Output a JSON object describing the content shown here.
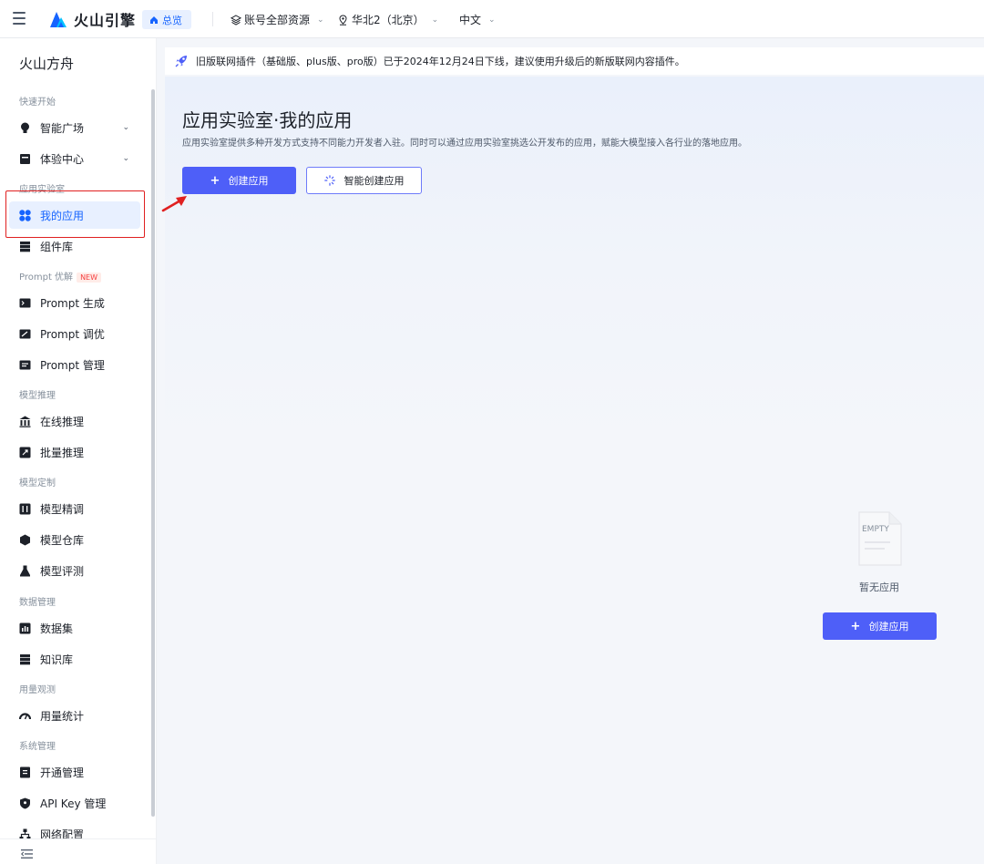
{
  "header": {
    "logo_text": "火山引擎",
    "home_label": "总览",
    "account_scope": "账号全部资源",
    "region": "华北2（北京）",
    "language": "中文"
  },
  "sidebar": {
    "title": "火山方舟",
    "groups": {
      "quick_start": "快速开始",
      "app_lab": "应用实验室",
      "prompt_opt": "Prompt 优解",
      "prompt_opt_badge": "NEW",
      "model_infer": "模型推理",
      "model_custom": "模型定制",
      "data_mgmt": "数据管理",
      "usage": "用量观测",
      "system": "系统管理"
    },
    "items": {
      "smart_square": "智能广场",
      "experience_center": "体验中心",
      "my_apps": "我的应用",
      "component_lib": "组件库",
      "prompt_gen": "Prompt 生成",
      "prompt_tune": "Prompt 调优",
      "prompt_manage": "Prompt 管理",
      "online_infer": "在线推理",
      "batch_infer": "批量推理",
      "model_finetune": "模型精调",
      "model_repo": "模型仓库",
      "model_eval": "模型评测",
      "dataset": "数据集",
      "knowledge_base": "知识库",
      "usage_stats": "用量统计",
      "activation": "开通管理",
      "api_key": "API Key 管理",
      "network_config": "网络配置"
    },
    "active_item": "my_apps"
  },
  "notice": {
    "text": "旧版联网插件（基础版、plus版、pro版）已于2024年12月24日下线，建议使用升级后的新版联网内容插件。"
  },
  "main": {
    "title": "应用实验室·我的应用",
    "description": "应用实验室提供多种开发方式支持不同能力开发者入驻。同时可以通过应用实验室挑选公开发布的应用，赋能大模型接入各行业的落地应用。",
    "create_button": "创建应用",
    "smart_create_button": "智能创建应用",
    "empty_icon_text": "EMPTY",
    "empty_text": "暂无应用",
    "empty_create_button": "创建应用"
  },
  "colors": {
    "primary": "#4e5ff8",
    "brand_blue": "#1664ff",
    "annotation_red": "#e02020"
  }
}
